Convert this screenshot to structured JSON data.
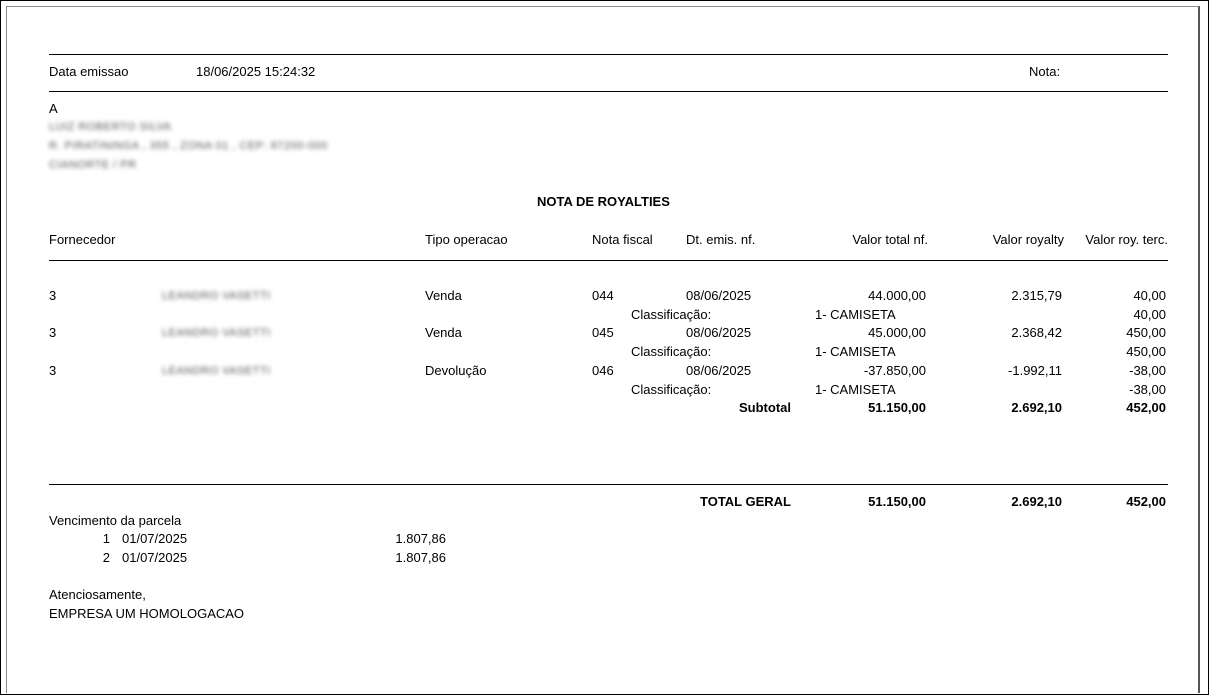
{
  "header": {
    "emission_label": "Data emissao",
    "emission_value": "18/06/2025 15:24:32",
    "nota_label": "Nota:"
  },
  "recipient": {
    "salutation": "A",
    "line1": "LUIZ ROBERTO SILVA",
    "line2": "R. PIRATININGA , 355 , ZONA 01 , CEP: 87200-000",
    "line3": "CIANORTE / PR"
  },
  "title": "NOTA DE ROYALTIES",
  "columns": {
    "fornecedor": "Fornecedor",
    "tipo": "Tipo operacao",
    "nota": "Nota fiscal",
    "dt": "Dt. emis. nf.",
    "valor_total": "Valor total nf.",
    "valor_royalty": "Valor royalty",
    "valor_terc": "Valor roy. terc."
  },
  "rows": [
    {
      "code": "3",
      "name": "LEANDRO VASETTI",
      "tipo": "Venda",
      "nota": "044",
      "dt": "08/06/2025",
      "total": "44.000,00",
      "royalty": "2.315,79",
      "terc": "40,00",
      "class_label": "Classificação:",
      "class_value": "1- CAMISETA",
      "class_terc": "40,00"
    },
    {
      "code": "3",
      "name": "LEANDRO VASETTI",
      "tipo": "Venda",
      "nota": "045",
      "dt": "08/06/2025",
      "total": "45.000,00",
      "royalty": "2.368,42",
      "terc": "450,00",
      "class_label": "Classificação:",
      "class_value": "1- CAMISETA",
      "class_terc": "450,00"
    },
    {
      "code": "3",
      "name": "LEANDRO VASETTI",
      "tipo": "Devolução",
      "nota": "046",
      "dt": "08/06/2025",
      "total": "-37.850,00",
      "royalty": "-1.992,11",
      "terc": "-38,00",
      "class_label": "Classificação:",
      "class_value": "1- CAMISETA",
      "class_terc": "-38,00"
    }
  ],
  "subtotal": {
    "label": "Subtotal",
    "total": "51.150,00",
    "royalty": "2.692,10",
    "terc": "452,00"
  },
  "grand_total": {
    "label": "TOTAL GERAL",
    "total": "51.150,00",
    "royalty": "2.692,10",
    "terc": "452,00"
  },
  "installments": {
    "label": "Vencimento da parcela",
    "items": [
      {
        "n": "1",
        "date": "01/07/2025",
        "value": "1.807,86"
      },
      {
        "n": "2",
        "date": "01/07/2025",
        "value": "1.807,86"
      }
    ]
  },
  "closing": {
    "regards": "Atenciosamente,",
    "company": "EMPRESA UM HOMOLOGACAO"
  }
}
